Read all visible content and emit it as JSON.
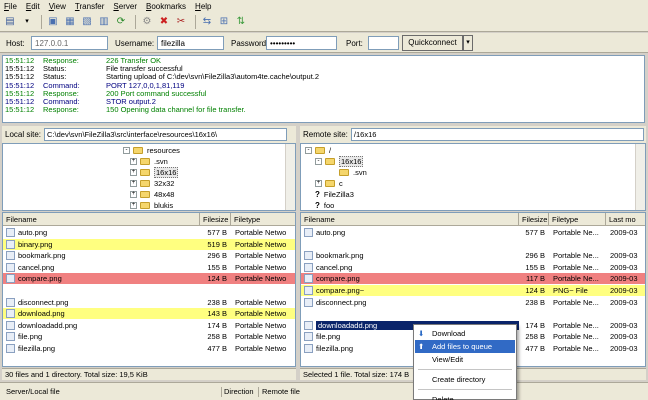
{
  "menu": [
    {
      "label": "File",
      "u": "F",
      "rest": "ile"
    },
    {
      "label": "Edit",
      "u": "E",
      "rest": "dit"
    },
    {
      "label": "View",
      "u": "V",
      "rest": "iew"
    },
    {
      "label": "Transfer",
      "u": "T",
      "rest": "ransfer"
    },
    {
      "label": "Server",
      "u": "S",
      "rest": "erver"
    },
    {
      "label": "Bookmarks",
      "u": "B",
      "rest": "ookmarks"
    },
    {
      "label": "Help",
      "u": "H",
      "rest": "elp"
    }
  ],
  "quick": {
    "host_label": "Host:",
    "host_value": "127.0.0.1",
    "user_label": "Username:",
    "user_value": "filezilla",
    "pass_label": "Password:",
    "pass_value": "•••••••••",
    "port_label": "Port:",
    "port_value": "",
    "button": "Quickconnect"
  },
  "log": [
    {
      "time": "15:51:12",
      "kind": "Response:",
      "msg": "226 Transfer OK",
      "cls": "c-response"
    },
    {
      "time": "15:51:12",
      "kind": "Status:",
      "msg": "File transfer successful",
      "cls": "c-status"
    },
    {
      "time": "15:51:12",
      "kind": "Status:",
      "msg": "Starting upload of C:\\dev\\svn\\FileZilla3\\autom4te.cache\\output.2",
      "cls": "c-status"
    },
    {
      "time": "15:51:12",
      "kind": "Command:",
      "msg": "PORT 127,0,0,1,81,119",
      "cls": "c-command"
    },
    {
      "time": "15:51:12",
      "kind": "Response:",
      "msg": "200 Port command successful",
      "cls": "c-response"
    },
    {
      "time": "15:51:12",
      "kind": "Command:",
      "msg": "STOR output.2",
      "cls": "c-command"
    },
    {
      "time": "15:51:12",
      "kind": "Response:",
      "msg": "150 Opening data channel for file transfer.",
      "cls": "c-response"
    }
  ],
  "local": {
    "site_label": "Local site:",
    "site_path": "C:\\dev\\svn\\FileZilla3\\src\\interface\\resources\\16x16\\",
    "tree": [
      {
        "label": "resources",
        "exp": "-"
      },
      {
        "label": ".svn",
        "exp": "+"
      },
      {
        "label": "16x16",
        "exp": "+",
        "sel": true
      },
      {
        "label": "32x32",
        "exp": "+"
      },
      {
        "label": "48x48",
        "exp": "+"
      },
      {
        "label": "blukis",
        "exp": "+"
      }
    ],
    "headers": {
      "name": "Filename",
      "size": "Filesize",
      "type": "Filetype"
    },
    "files": [
      {
        "name": "auto.png",
        "size": "577 B",
        "type": "Portable Netwo",
        "bg": "#ffffff"
      },
      {
        "name": "binary.png",
        "size": "519 B",
        "type": "Portable Netwo",
        "bg": "#ffff80"
      },
      {
        "name": "bookmark.png",
        "size": "296 B",
        "type": "Portable Netwo",
        "bg": "#ffffff"
      },
      {
        "name": "cancel.png",
        "size": "155 B",
        "type": "Portable Netwo",
        "bg": "#ffffff"
      },
      {
        "name": "compare.png",
        "size": "124 B",
        "type": "Portable Netwo",
        "bg": "#f08080"
      },
      {
        "name": "",
        "size": "",
        "type": "",
        "bg": "#ffffff"
      },
      {
        "name": "disconnect.png",
        "size": "238 B",
        "type": "Portable Netwo",
        "bg": "#ffffff"
      },
      {
        "name": "download.png",
        "size": "143 B",
        "type": "Portable Netwo",
        "bg": "#ffff80"
      },
      {
        "name": "downloadadd.png",
        "size": "174 B",
        "type": "Portable Netwo",
        "bg": "#ffffff"
      },
      {
        "name": "file.png",
        "size": "258 B",
        "type": "Portable Netwo",
        "bg": "#ffffff"
      },
      {
        "name": "filezilla.png",
        "size": "477 B",
        "type": "Portable Netwo",
        "bg": "#ffffff"
      }
    ],
    "status": "30 files and 1 directory. Total size: 19,5 KiB"
  },
  "remote": {
    "site_label": "Remote site:",
    "site_path": "/16x16",
    "tree": [
      {
        "label": "/",
        "exp": "-"
      },
      {
        "label": "16x16",
        "exp": "-",
        "sel": true
      },
      {
        "label": ".svn",
        "exp": ""
      },
      {
        "label": "c",
        "exp": "+"
      },
      {
        "label": "FileZilla3",
        "exp": "?"
      },
      {
        "label": "foo",
        "exp": "?"
      }
    ],
    "headers": {
      "name": "Filename",
      "size": "Filesize",
      "type": "Filetype",
      "mod": "Last mo"
    },
    "files": [
      {
        "name": "auto.png",
        "size": "577 B",
        "type": "Portable Ne...",
        "mod": "2009-03",
        "bg": "#ffffff"
      },
      {
        "name": "",
        "size": "",
        "type": "",
        "mod": "",
        "bg": "#ffffff"
      },
      {
        "name": "bookmark.png",
        "size": "296 B",
        "type": "Portable Ne...",
        "mod": "2009-03",
        "bg": "#ffffff"
      },
      {
        "name": "cancel.png",
        "size": "155 B",
        "type": "Portable Ne...",
        "mod": "2009-03",
        "bg": "#ffffff"
      },
      {
        "name": "compare.png",
        "size": "117 B",
        "type": "Portable Ne...",
        "mod": "2009-03",
        "bg": "#f08080"
      },
      {
        "name": "compare.png~",
        "size": "124 B",
        "type": "PNG~ File",
        "mod": "2009-03",
        "bg": "#ffff80"
      },
      {
        "name": "disconnect.png",
        "size": "238 B",
        "type": "Portable Ne...",
        "mod": "2009-03",
        "bg": "#ffffff"
      },
      {
        "name": "",
        "size": "",
        "type": "",
        "mod": "",
        "bg": "#ffffff"
      },
      {
        "name": "downloadadd.png",
        "size": "174 B",
        "type": "Portable Ne...",
        "mod": "2009-03",
        "bg": "#0a246a",
        "sel": true
      },
      {
        "name": "file.png",
        "size": "258 B",
        "type": "Portable Ne...",
        "mod": "2009-03",
        "bg": "#ffffff"
      },
      {
        "name": "filezilla.png",
        "size": "477 B",
        "type": "Portable Ne...",
        "mod": "2009-03",
        "bg": "#ffffff"
      }
    ],
    "status": "Selected 1 file. Total size: 174 B"
  },
  "context_menu": [
    {
      "label": "Download",
      "icon": "download-icon"
    },
    {
      "label": "Add files to queue",
      "icon": "queue-icon",
      "hl": true
    },
    {
      "label": "View/Edit"
    },
    {
      "sep": true
    },
    {
      "label": "Create directory"
    },
    {
      "sep": true
    },
    {
      "label": "Delete"
    }
  ],
  "queue": {
    "col1": "Server/Local file",
    "col2": "Direction",
    "col3": "Remote file"
  }
}
